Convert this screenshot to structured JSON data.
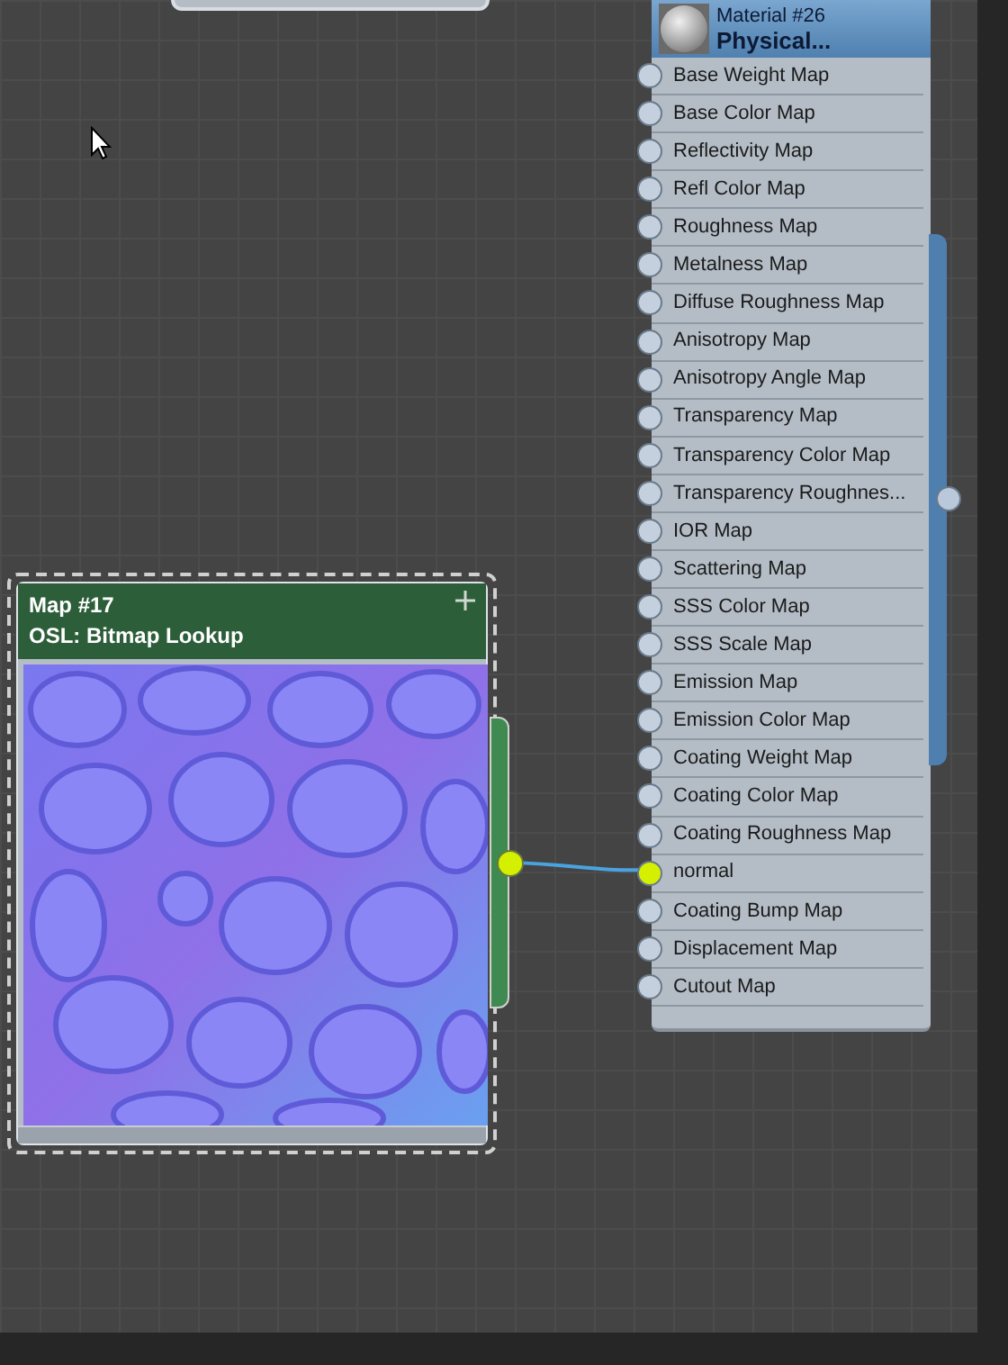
{
  "material_node": {
    "title": "Material #26",
    "subtitle": "Physical...",
    "slots": [
      {
        "label": "Base Weight Map",
        "connected": false
      },
      {
        "label": "Base Color Map",
        "connected": false
      },
      {
        "label": "Reflectivity Map",
        "connected": false
      },
      {
        "label": "Refl Color Map",
        "connected": false
      },
      {
        "label": "Roughness Map",
        "connected": false
      },
      {
        "label": "Metalness Map",
        "connected": false
      },
      {
        "label": "Diffuse Roughness Map",
        "connected": false
      },
      {
        "label": "Anisotropy Map",
        "connected": false
      },
      {
        "label": "Anisotropy Angle Map",
        "connected": false
      },
      {
        "label": "Transparency Map",
        "connected": false
      },
      {
        "label": "Transparency Color Map",
        "connected": false
      },
      {
        "label": "Transparency Roughnes...",
        "connected": false
      },
      {
        "label": "IOR Map",
        "connected": false
      },
      {
        "label": "Scattering Map",
        "connected": false
      },
      {
        "label": "SSS Color Map",
        "connected": false
      },
      {
        "label": "SSS Scale Map",
        "connected": false
      },
      {
        "label": "Emission Map",
        "connected": false
      },
      {
        "label": "Emission Color Map",
        "connected": false
      },
      {
        "label": "Coating Weight Map",
        "connected": false
      },
      {
        "label": "Coating Color Map",
        "connected": false
      },
      {
        "label": "Coating Roughness Map",
        "connected": false
      },
      {
        "label": "normal",
        "connected": true
      },
      {
        "label": "Coating Bump Map",
        "connected": false
      },
      {
        "label": "Displacement Map",
        "connected": false
      },
      {
        "label": "Cutout Map",
        "connected": false
      }
    ]
  },
  "map_node": {
    "title": "Map #17",
    "subtitle": "OSL: Bitmap Lookup",
    "selected": true,
    "connected": true
  }
}
